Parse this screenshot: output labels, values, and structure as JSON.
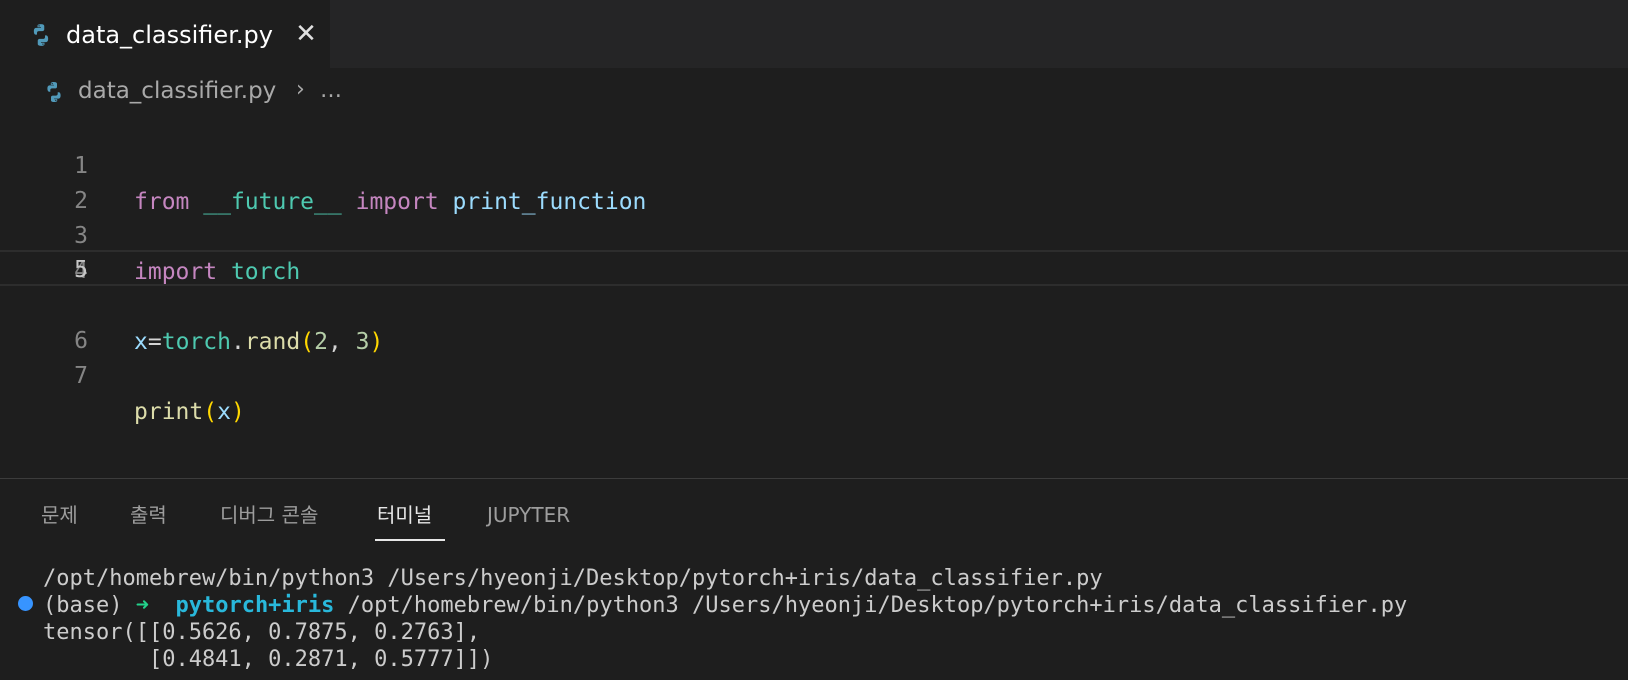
{
  "tab": {
    "filename": "data_classifier.py",
    "close_glyph": "✕"
  },
  "breadcrumb": {
    "file": "data_classifier.py",
    "separator": "›",
    "more": "…"
  },
  "editor": {
    "line_numbers": [
      "1",
      "2",
      "3",
      "4",
      "5",
      "6",
      "7"
    ],
    "current_line": 5,
    "lines": {
      "l1": {
        "kw_from": "from",
        "module": "__future__",
        "kw_import": "import",
        "name": "print_function"
      },
      "l3": {
        "kw_import": "import",
        "module": "torch"
      },
      "l5": {
        "var": "x",
        "eq": "=",
        "module": "torch",
        "dot": ".",
        "fn": "rand",
        "open": "(",
        "arg1": "2",
        "comma": ", ",
        "arg2": "3",
        "close": ")"
      },
      "l7": {
        "fn": "print",
        "open": "(",
        "arg": "x",
        "close": ")"
      }
    }
  },
  "panel": {
    "tabs": [
      "문제",
      "출력",
      "디버그 콘솔",
      "터미널",
      "JUPYTER"
    ],
    "active_tab": "터미널"
  },
  "terminal": {
    "line1": "/opt/homebrew/bin/python3 /Users/hyeonji/Desktop/pytorch+iris/data_classifier.py",
    "prompt_env": "(base) ",
    "prompt_arrow": "➜",
    "prompt_dir": "pytorch+iris",
    "prompt_cmd": " /opt/homebrew/bin/python3 /Users/hyeonji/Desktop/pytorch+iris/data_classifier.py",
    "output1": "tensor([[0.5626, 0.7875, 0.2763],",
    "output2": "        [0.4841, 0.2871, 0.5777]])"
  },
  "colors": {
    "keyword": "#c586c0",
    "module": "#4ec9b0",
    "variable": "#9cdcfe",
    "function": "#dcdcaa",
    "number": "#b5cea8",
    "bracket": "#ffd700",
    "prompt_arrow": "#23d18b",
    "prompt_dir": "#29b8db",
    "status_dot": "#3794ff"
  },
  "icons": {
    "file": "python-icon",
    "close": "close-icon",
    "terminal_status": "circle-dot-icon"
  }
}
